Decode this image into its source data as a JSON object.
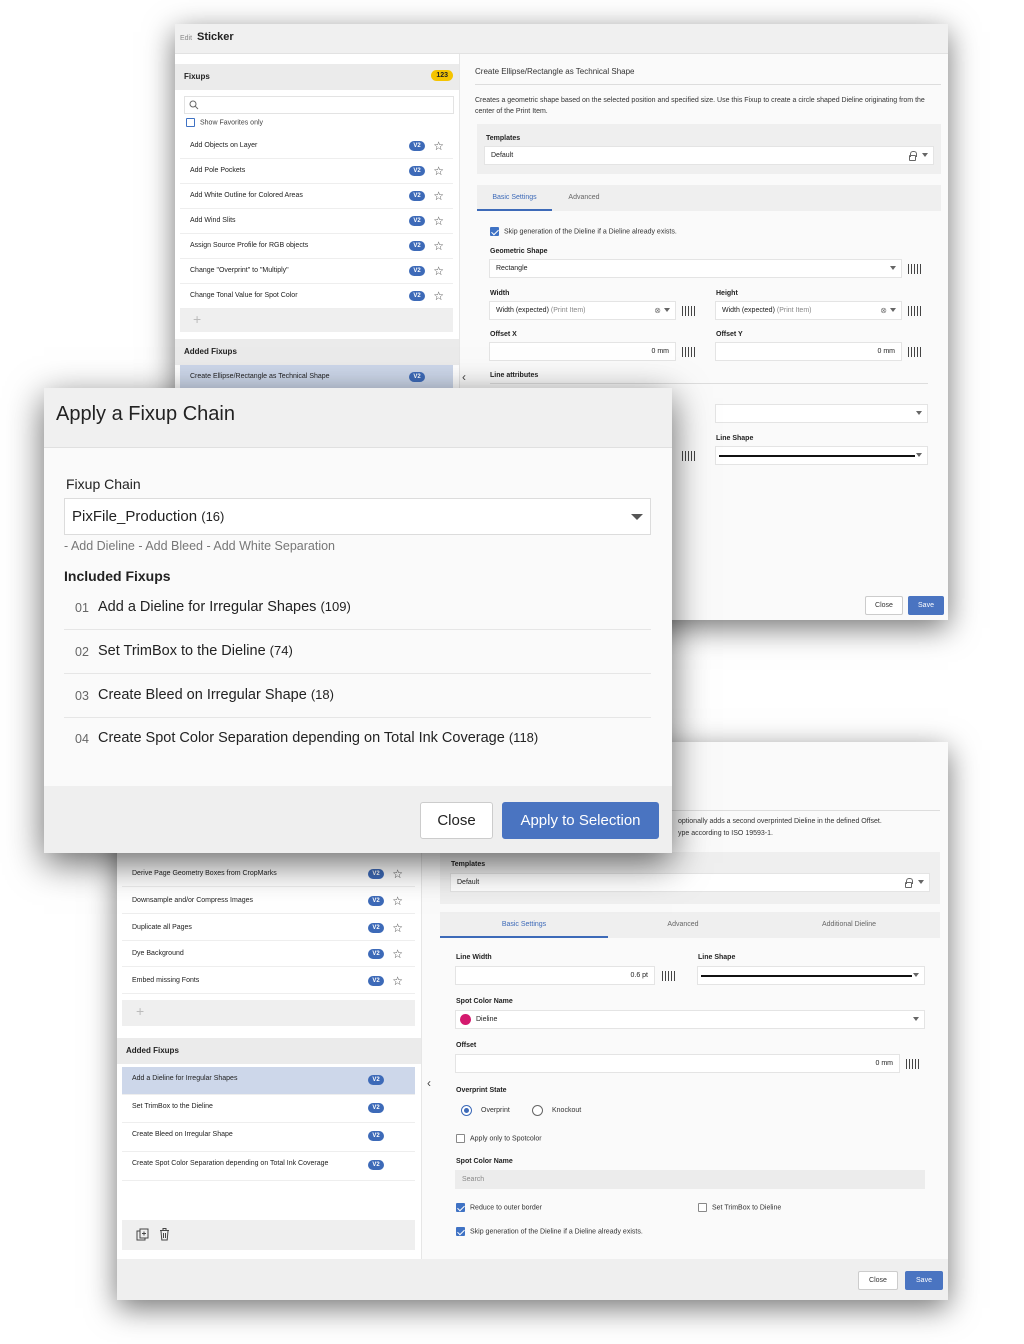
{
  "window1": {
    "edit_label": "Edit",
    "title": "Sticker",
    "fixups_header": "Fixups",
    "fixups_count": "123",
    "show_favorites": "Show Favorites only",
    "fixups": [
      {
        "label": "Add Objects on Layer",
        "badge": "V2"
      },
      {
        "label": "Add Pole Pockets",
        "badge": "V2"
      },
      {
        "label": "Add White Outline for Colored Areas",
        "badge": "V2"
      },
      {
        "label": "Add Wind Slits",
        "badge": "V2"
      },
      {
        "label": "Assign Source Profile for RGB objects",
        "badge": "V2"
      },
      {
        "label": "Change \"Overprint\" to \"Multiply\"",
        "badge": "V2"
      },
      {
        "label": "Change Tonal Value for Spot Color",
        "badge": "V2"
      }
    ],
    "added_fixups_header": "Added Fixups",
    "added_fixups": [
      {
        "label": "Create Ellipse/Rectangle as Technical Shape",
        "badge": "V2"
      }
    ],
    "detail": {
      "heading": "Create Ellipse/Rectangle as Technical Shape",
      "description": "Creates a geometric shape based on the selected position and specified size. Use this Fixup to create a circle shaped Dieline originating from the center of the Print Item.",
      "templates_label": "Templates",
      "templates_value": "Default",
      "tabs": [
        "Basic Settings",
        "Advanced"
      ],
      "skip_generation": "Skip generation of the Dieline if a Dieline already exists.",
      "geometric_shape_label": "Geometric Shape",
      "geometric_shape_value": "Rectangle",
      "width_label": "Width",
      "width_value": "Width (expected)",
      "width_hint": "(Print Item)",
      "height_label": "Height",
      "height_value": "Width (expected)",
      "height_hint": "(Print Item)",
      "offset_x_label": "Offset X",
      "offset_x_value": "0 mm",
      "offset_y_label": "Offset Y",
      "offset_y_value": "0 mm",
      "line_attributes_label": "Line attributes",
      "line_shape_label": "Line Shape"
    },
    "close": "Close",
    "save": "Save"
  },
  "dialog": {
    "title": "Apply a Fixup Chain",
    "chain_label": "Fixup Chain",
    "chain_value": "PixFile_Production",
    "chain_count": "(16)",
    "chain_description": "- Add Dieline - Add Bleed - Add White Separation",
    "included_label": "Included Fixups",
    "items": [
      {
        "num": "01",
        "name": "Add a Dieline for Irregular Shapes",
        "count": "(109)"
      },
      {
        "num": "02",
        "name": "Set TrimBox to the Dieline",
        "count": "(74)"
      },
      {
        "num": "03",
        "name": "Create Bleed on Irregular Shape",
        "count": "(18)"
      },
      {
        "num": "04",
        "name": "Create Spot Color Separation depending on Total Ink Coverage",
        "count": "(118)"
      }
    ],
    "close": "Close",
    "apply": "Apply to Selection"
  },
  "window2": {
    "description_line1": "optionally adds a second overprinted Dieline in the defined Offset.",
    "description_line2": "ype according to ISO 19593-1.",
    "fixups": [
      {
        "label": "Derive Page Geometry Boxes from CropMarks",
        "badge": "V2"
      },
      {
        "label": "Downsample and/or Compress Images",
        "badge": "V2"
      },
      {
        "label": "Duplicate all Pages",
        "badge": "V2"
      },
      {
        "label": "Dye Background",
        "badge": "V2"
      },
      {
        "label": "Embed missing Fonts",
        "badge": "V2"
      }
    ],
    "added_fixups_header": "Added Fixups",
    "added_fixups": [
      {
        "label": "Add a Dieline for Irregular Shapes",
        "badge": "V2"
      },
      {
        "label": "Set TrimBox to the Dieline",
        "badge": "V2"
      },
      {
        "label": "Create Bleed on Irregular Shape",
        "badge": "V2"
      },
      {
        "label": "Create Spot Color Separation depending on Total Ink Coverage",
        "badge": "V2"
      }
    ],
    "detail": {
      "templates_label": "Templates",
      "templates_value": "Default",
      "tabs": [
        "Basic Settings",
        "Advanced",
        "Additional Dieline"
      ],
      "line_width_label": "Line Width",
      "line_width_value": "0.6 pt",
      "line_shape_label": "Line Shape",
      "spot_color_name_label": "Spot Color Name",
      "spot_color_value": "Dieline",
      "spot_color_swatch": "#d4196e",
      "offset_label": "Offset",
      "offset_value": "0 mm",
      "overprint_state_label": "Overprint State",
      "overprint_option": "Overprint",
      "knockout_option": "Knockout",
      "apply_only_spot": "Apply only to Spotcolor",
      "spot_color_name_label2": "Spot Color Name",
      "search_placeholder": "Search",
      "reduce_outer": "Reduce to outer border",
      "set_trimbox": "Set TrimBox to Dieline",
      "skip_generation": "Skip generation of the Dieline if a Dieline already exists."
    },
    "close": "Close",
    "save": "Save"
  },
  "colors": {
    "accent": "#3d6ab8",
    "save_button": "#4a74c1",
    "count_badge": "#f5c400"
  }
}
